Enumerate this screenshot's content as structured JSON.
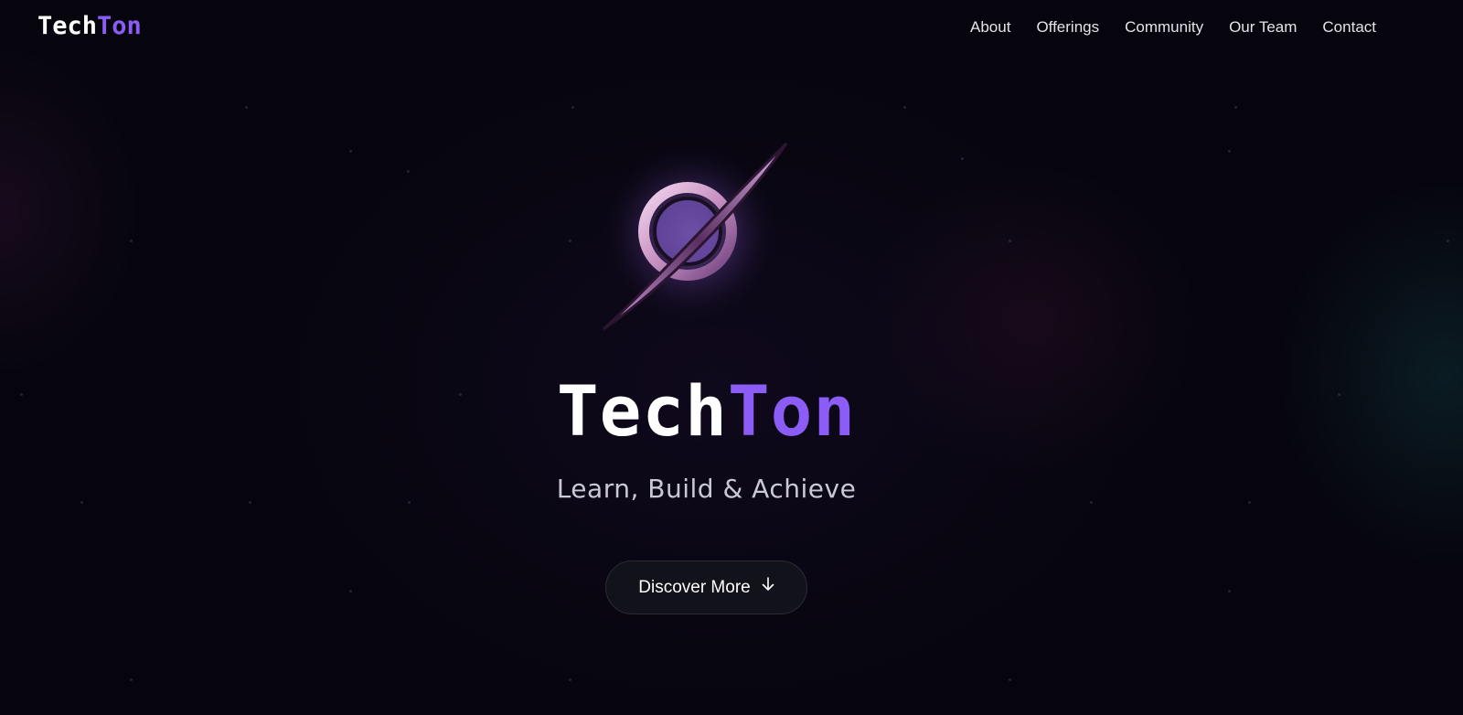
{
  "brand": {
    "name_part1": "Tech",
    "name_part2": "Ton",
    "accent_color": "#8b5cf6"
  },
  "nav": {
    "links": [
      {
        "label": "About"
      },
      {
        "label": "Offerings"
      },
      {
        "label": "Community"
      },
      {
        "label": "Our Team"
      },
      {
        "label": "Contact"
      }
    ]
  },
  "hero": {
    "logo_icon": "ringed-planet-icon",
    "title_part1": "Tech",
    "title_part2": "Ton",
    "tagline": "Learn, Build & Achieve",
    "cta_label": "Discover More",
    "cta_icon": "arrow-down-icon"
  },
  "theme": {
    "background": "#06050d",
    "text": "#ffffff",
    "muted_text": "#c9c8d6",
    "button_bg": "#12121a"
  }
}
